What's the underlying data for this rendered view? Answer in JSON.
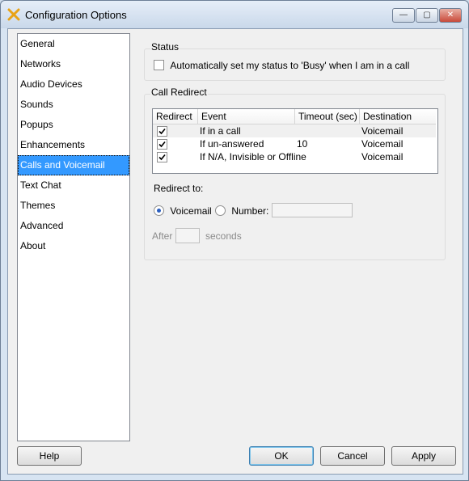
{
  "window": {
    "title": "Configuration Options"
  },
  "title_buttons": {
    "minimize": "—",
    "maximize": "▢",
    "close": "✕"
  },
  "nav": {
    "items": [
      "General",
      "Networks",
      "Audio Devices",
      "Sounds",
      "Popups",
      "Enhancements",
      "Calls and Voicemail",
      "Text Chat",
      "Themes",
      "Advanced",
      "About"
    ],
    "selected": "Calls and Voicemail"
  },
  "status": {
    "label": "Status",
    "busy_checkbox": {
      "label": "Automatically set my status to 'Busy' when I am in a call",
      "checked": false
    }
  },
  "call_redirect": {
    "label": "Call Redirect",
    "columns": [
      "Redirect",
      "Event",
      "Timeout (sec)",
      "Destination"
    ],
    "rows": [
      {
        "redirect": true,
        "event": "If in a call",
        "timeout": "",
        "destination": "Voicemail"
      },
      {
        "redirect": true,
        "event": "If un-answered",
        "timeout": "10",
        "destination": "Voicemail"
      },
      {
        "redirect": true,
        "event": "If N/A, Invisible or Offline",
        "timeout": "",
        "destination": "Voicemail"
      }
    ],
    "redirect_to_label": "Redirect to:",
    "voicemail_label": "Voicemail",
    "number_label": "Number:",
    "number_value": "",
    "after_label": "After",
    "after_value": "",
    "seconds_label": "seconds",
    "selected_option": "Voicemail"
  },
  "buttons": {
    "help": "Help",
    "ok": "OK",
    "cancel": "Cancel",
    "apply": "Apply"
  },
  "icons": {
    "app": "app-logo-icon",
    "check": "checkmark-icon"
  },
  "colors": {
    "selection": "#3399ff",
    "titlebar": "#c9d8ea"
  }
}
